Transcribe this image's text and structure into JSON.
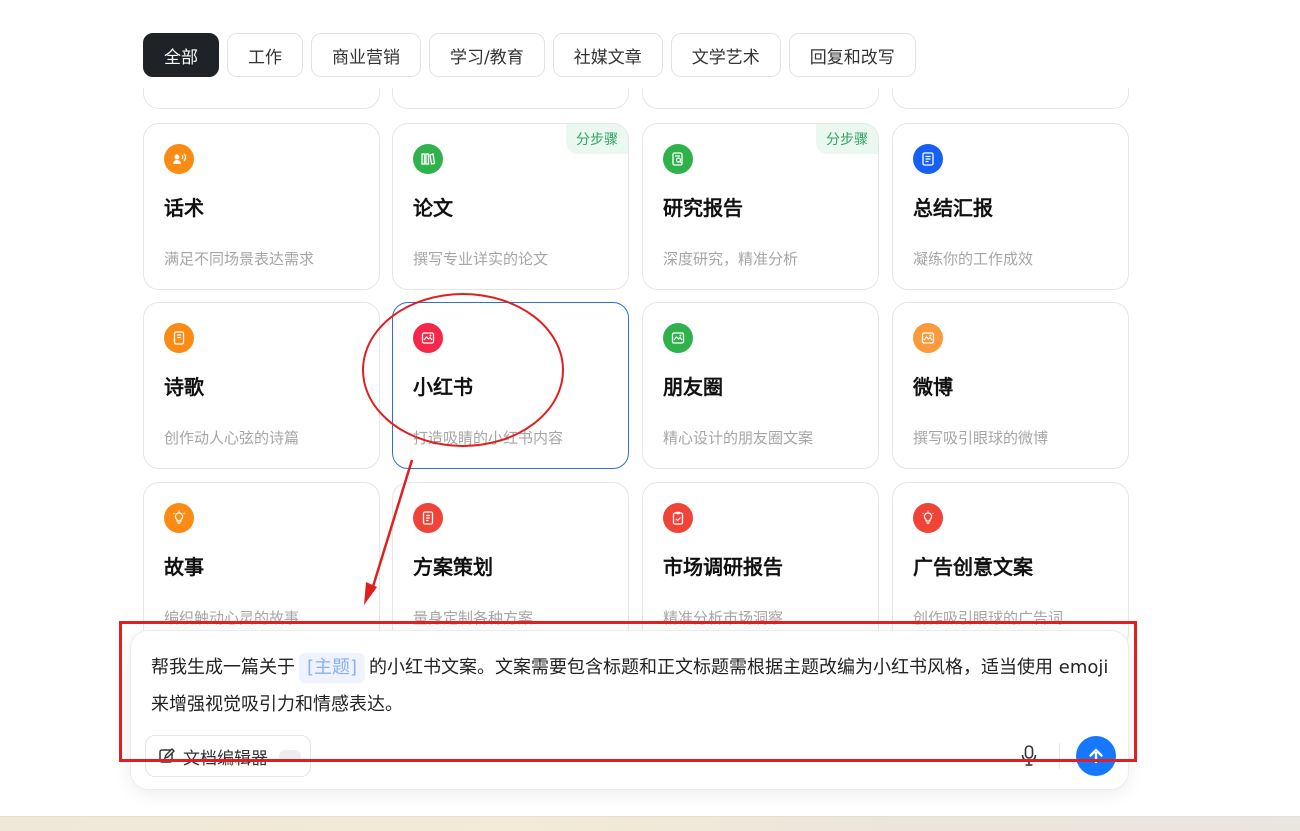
{
  "tabs": [
    "全部",
    "工作",
    "商业营销",
    "学习/教育",
    "社媒文章",
    "文学艺术",
    "回复和改写"
  ],
  "cards": [
    {
      "title": "话术",
      "desc": "满足不同场景表达需求",
      "icon": "voice-icon",
      "color": "#fa8c16",
      "badge": ""
    },
    {
      "title": "论文",
      "desc": "撰写专业详实的论文",
      "icon": "library-icon",
      "color": "#2fb24c",
      "badge": "分步骤"
    },
    {
      "title": "研究报告",
      "desc": "深度研究，精准分析",
      "icon": "document-search-icon",
      "color": "#2fb24c",
      "badge": "分步骤"
    },
    {
      "title": "总结汇报",
      "desc": "凝练你的工作成效",
      "icon": "document-icon",
      "color": "#1660f5",
      "badge": ""
    },
    {
      "title": "诗歌",
      "desc": "创作动人心弦的诗篇",
      "icon": "notebook-icon",
      "color": "#fa8c16",
      "badge": ""
    },
    {
      "title": "小红书",
      "desc": "打造吸睛的小红书内容",
      "icon": "image-post-icon",
      "color": "#f5284a",
      "badge": ""
    },
    {
      "title": "朋友圈",
      "desc": "精心设计的朋友圈文案",
      "icon": "image-post-icon",
      "color": "#2fb24c",
      "badge": ""
    },
    {
      "title": "微博",
      "desc": "撰写吸引眼球的微博",
      "icon": "image-post-icon",
      "color": "#fa9a3c",
      "badge": ""
    },
    {
      "title": "故事",
      "desc": "编织触动心灵的故事",
      "icon": "lightbulb-icon",
      "color": "#fa8c16",
      "badge": ""
    },
    {
      "title": "方案策划",
      "desc": "量身定制各种方案",
      "icon": "plan-icon",
      "color": "#f04438",
      "badge": ""
    },
    {
      "title": "市场调研报告",
      "desc": "精准分析市场洞察",
      "icon": "clipboard-icon",
      "color": "#f04438",
      "badge": ""
    },
    {
      "title": "广告创意文案",
      "desc": "创作吸引眼球的广告词",
      "icon": "lightbulb-icon",
      "color": "#f04438",
      "badge": ""
    }
  ],
  "input": {
    "text_before": "帮我生成一篇关于",
    "topic_placeholder": "[主题]",
    "text_after": "的小红书文案。文案需要包含标题和正文标题需根据主题改编为小红书风格，适当使用 emoji 来增强视觉吸引力和情感表达。",
    "doc_editor_label": "文档编辑器"
  },
  "colors": {
    "accent": "#1677ff",
    "annotation": "#e02020",
    "selected_border": "#2f6fd6"
  }
}
